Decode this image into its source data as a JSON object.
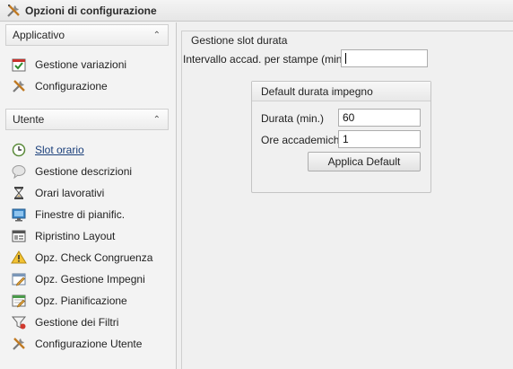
{
  "window": {
    "title": "Opzioni di configurazione",
    "icon": "tools-icon"
  },
  "sidebar": {
    "groups": [
      {
        "label": "Applicativo",
        "chevron": "chevron-up-icon",
        "items": [
          {
            "label": "Gestione variazioni",
            "icon": "calendar-variations-icon"
          },
          {
            "label": "Configurazione",
            "icon": "tools-icon"
          }
        ]
      },
      {
        "label": "Utente",
        "chevron": "chevron-up-icon",
        "items": [
          {
            "label": "Slot orario",
            "icon": "clock-slot-icon",
            "selected": true
          },
          {
            "label": "Gestione descrizioni",
            "icon": "speech-bubble-icon"
          },
          {
            "label": "Orari lavorativi",
            "icon": "hourglass-icon"
          },
          {
            "label": "Finestre di pianific.",
            "icon": "monitor-icon"
          },
          {
            "label": "Ripristino Layout",
            "icon": "layout-reset-icon"
          },
          {
            "label": "Opz. Check Congruenza",
            "icon": "warning-icon"
          },
          {
            "label": "Opz. Gestione Impegni",
            "icon": "window-edit-icon"
          },
          {
            "label": "Opz. Pianificazione",
            "icon": "calendar-edit-icon"
          },
          {
            "label": "Gestione dei Filtri",
            "icon": "filter-icon"
          },
          {
            "label": "Configurazione Utente",
            "icon": "tools-icon"
          }
        ]
      }
    ]
  },
  "main": {
    "section_title": "Gestione slot durata",
    "intervallo": {
      "label": "Intervallo accad. per stampe (min.)",
      "value": ""
    },
    "default_box": {
      "title": "Default durata impegno",
      "durata": {
        "label": "Durata (min.)",
        "value": "60"
      },
      "ore": {
        "label": "Ore accademiche",
        "value": "1"
      },
      "apply_button": "Applica Default"
    }
  }
}
